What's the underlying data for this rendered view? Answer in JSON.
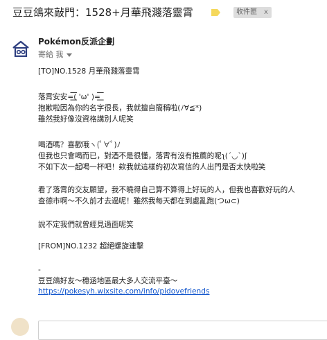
{
  "subject": {
    "title": "豆豆鴿來敲門：1528+月華飛濺落靈霄",
    "label_icon": "label-icon",
    "label_color": "#f5d85c",
    "folder_label": "收件匣",
    "folder_remove": "x"
  },
  "sender": {
    "name": "Pokémon反派企劃",
    "recipient": "寄給 我",
    "avatar_icon": "house-logo-icon"
  },
  "body": {
    "lines": [
      "[TO]NO.1528 月華飛濺落靈霄",
      "落霄安安=͟͟͞͞( 'ω' )=͟͟͞͞",
      "抱歉啦因為你的名字很長，我就擅自簡稱啦(ﾉ∀≦*)",
      "雖然我好像沒資格講別人呢笑",
      "喝酒嗎？喜歡哦ヽ(ﾟ∀ﾟ)ﾉ",
      "但我也只會喝而已，對酒不是很懂，落霄有沒有推薦的呢ʅ(´◡`)ʃ",
      "不如下次一起喝一杯吧！欸我就這樣約初次寫信的人出門是否太快啦笑",
      "看了落霄的交友願望，我不曉得自己算不算得上好玩的人，但我也喜歡好玩的人",
      "查德市啊～不久前才去過呢！雖然我每天都在到處亂跑(つω⊂)",
      "說不定我們就曾經見過面呢笑",
      "[FROM]NO.1232 超絕螺旋連擊",
      "-",
      "豆豆鴿好友～穗涵地區最大多人交流平臺～",
      "https://pokesyh.wixsite.com/info/pidovefriends"
    ]
  },
  "colors": {
    "link": "#1155cc",
    "text": "#222222",
    "muted": "#666666"
  }
}
